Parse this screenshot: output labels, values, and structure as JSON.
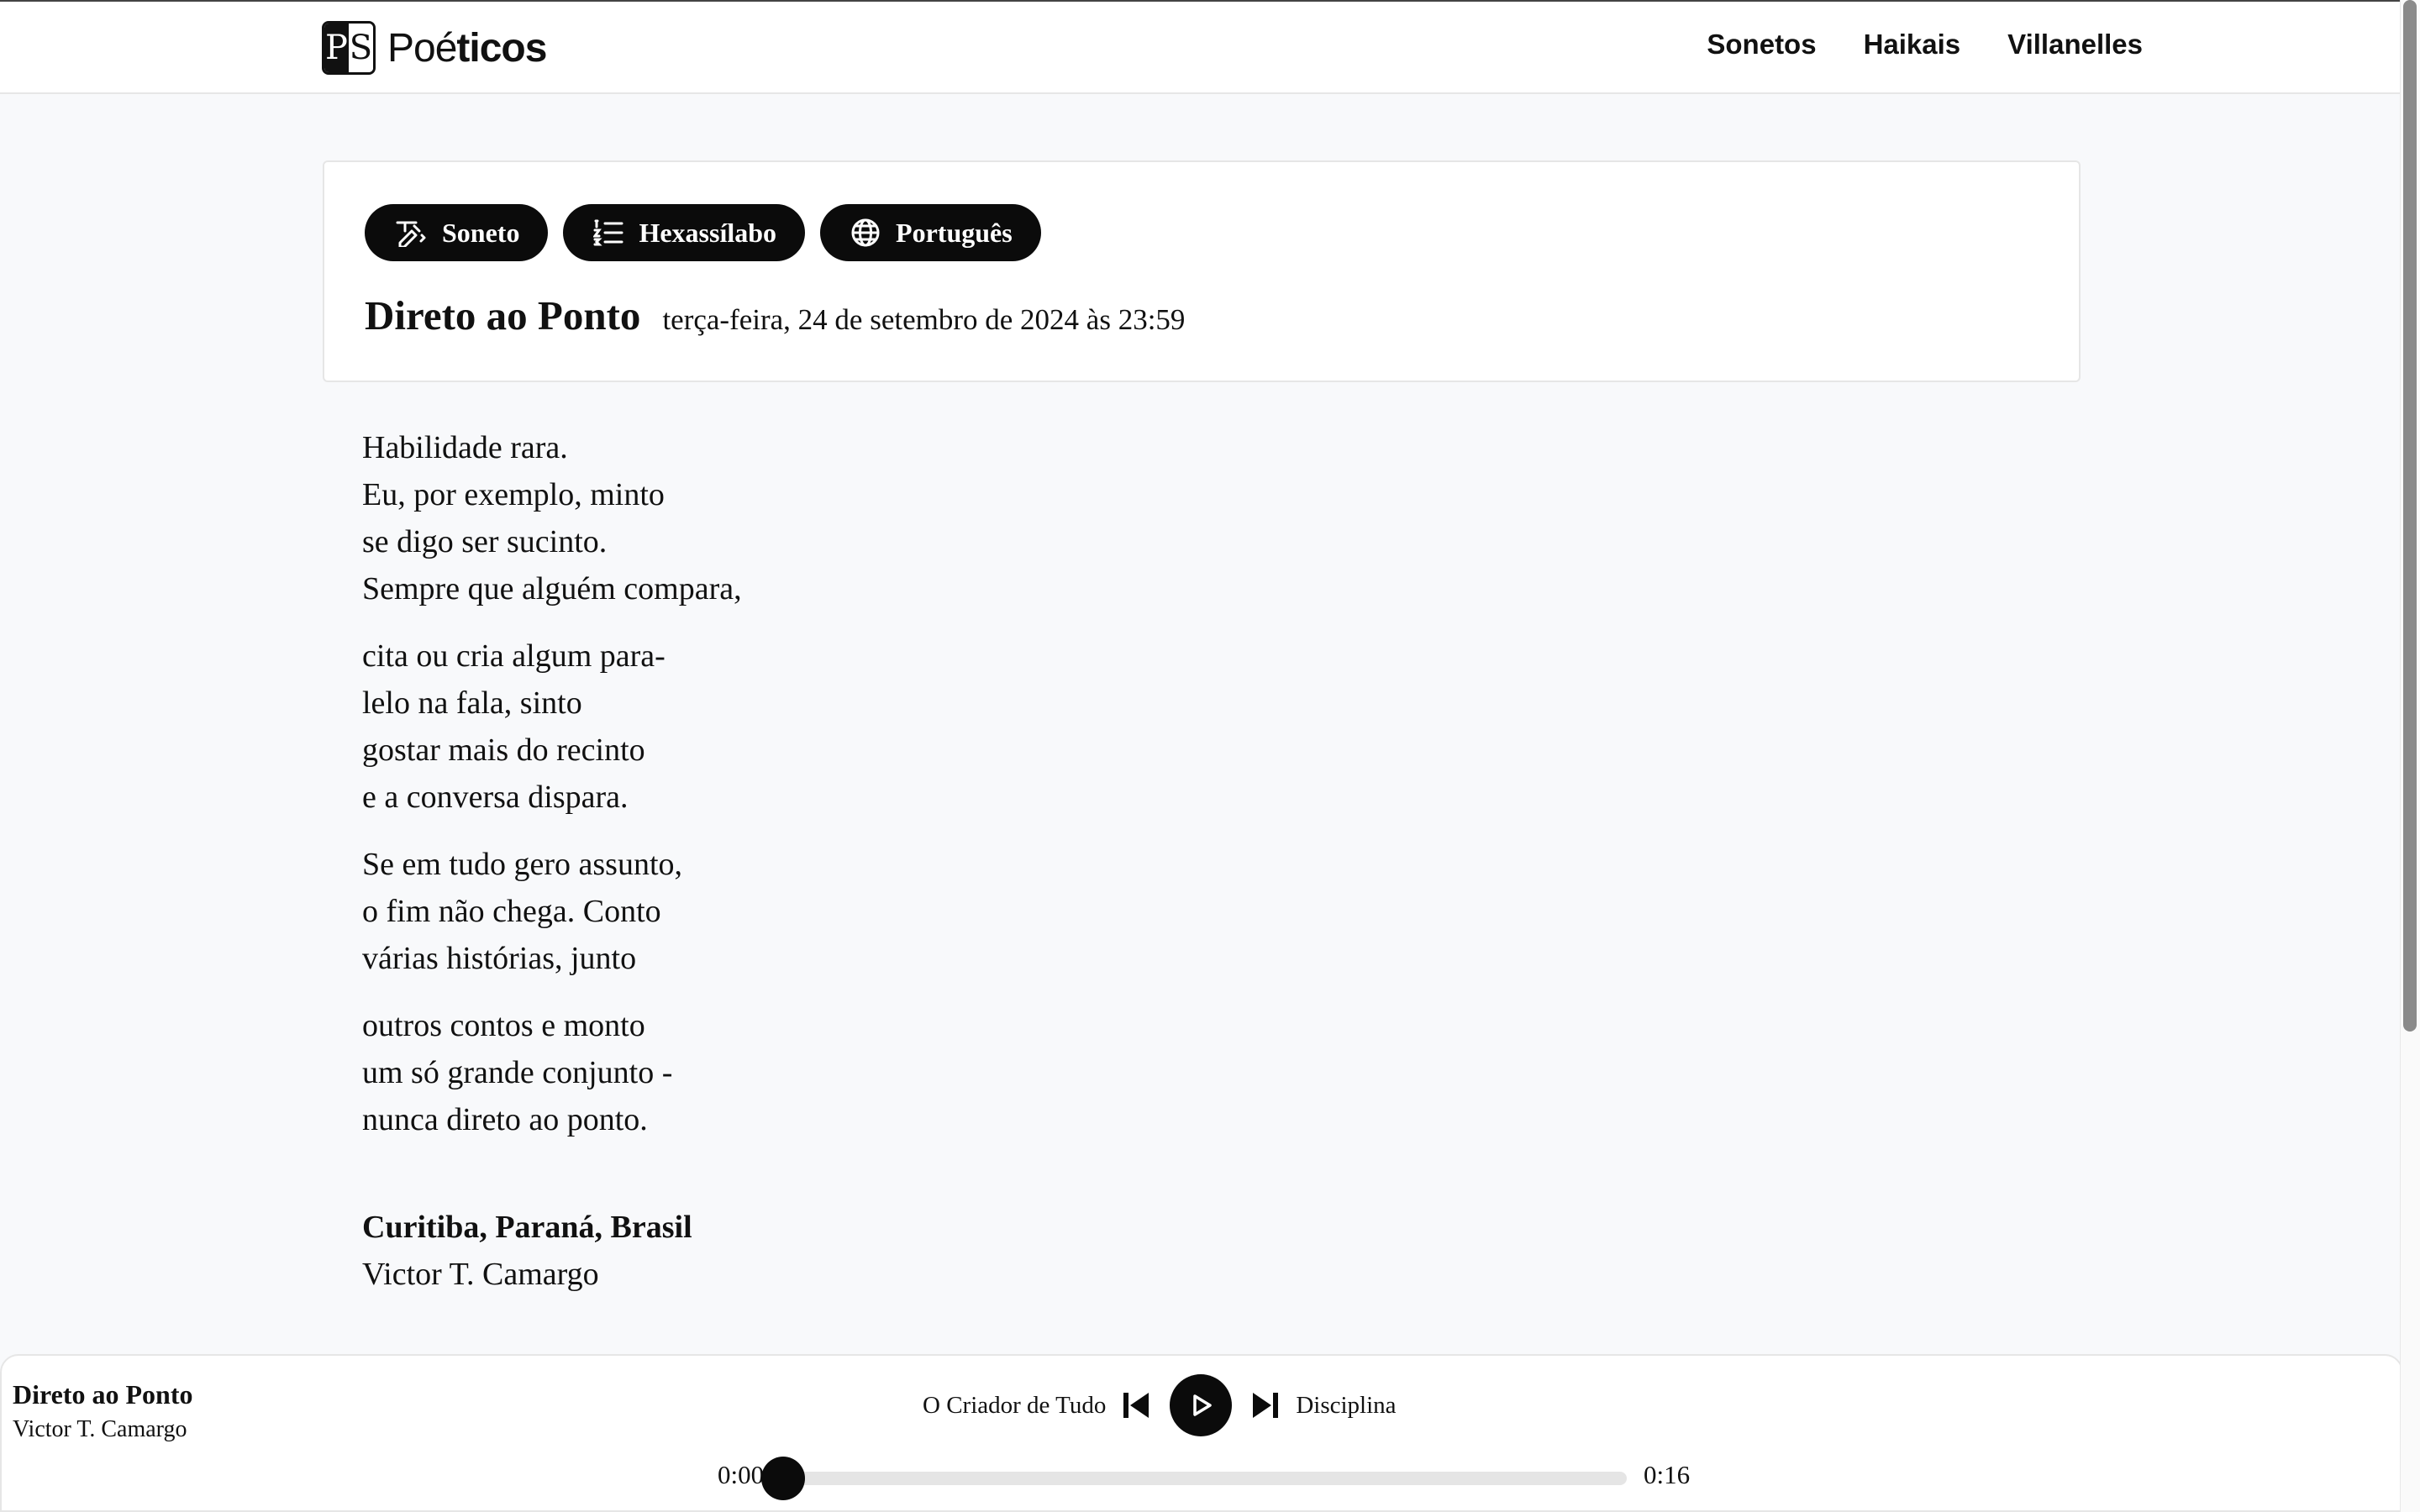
{
  "header": {
    "logo_left": "P",
    "logo_right": "S",
    "brand_light": "Poé",
    "brand_bold": "ticos",
    "nav": [
      "Sonetos",
      "Haikais",
      "Villanelles"
    ]
  },
  "poem": {
    "tags": [
      {
        "label": "Soneto",
        "icon": "sonnet-icon"
      },
      {
        "label": "Hexassílabo",
        "icon": "list-icon"
      },
      {
        "label": "Português",
        "icon": "globe-icon"
      }
    ],
    "title": "Direto ao Ponto",
    "date": "terça-feira, 24 de setembro de 2024 às 23:59",
    "stanzas": [
      [
        "Habilidade rara.",
        "Eu, por exemplo, minto",
        "se digo ser sucinto.",
        "Sempre que alguém compara,"
      ],
      [
        "cita ou cria algum para-",
        "lelo na fala, sinto",
        "gostar mais do recinto",
        "e a conversa dispara."
      ],
      [
        "Se em tudo gero assunto,",
        "o fim não chega. Conto",
        "várias histórias, junto"
      ],
      [
        "outros contos e monto",
        "um só grande conjunto -",
        "nunca direto ao ponto."
      ]
    ],
    "place": "Curitiba, Paraná, Brasil",
    "author": "Victor T. Camargo"
  },
  "player": {
    "title": "Direto ao Ponto",
    "author": "Victor T. Camargo",
    "previous_title": "O Criador de Tudo",
    "next_title": "Disciplina",
    "current_time": "0:00",
    "duration": "0:16",
    "progress": 0.0
  },
  "colors": {
    "accent": "#0b0b0b",
    "background": "#f8f9fb"
  }
}
